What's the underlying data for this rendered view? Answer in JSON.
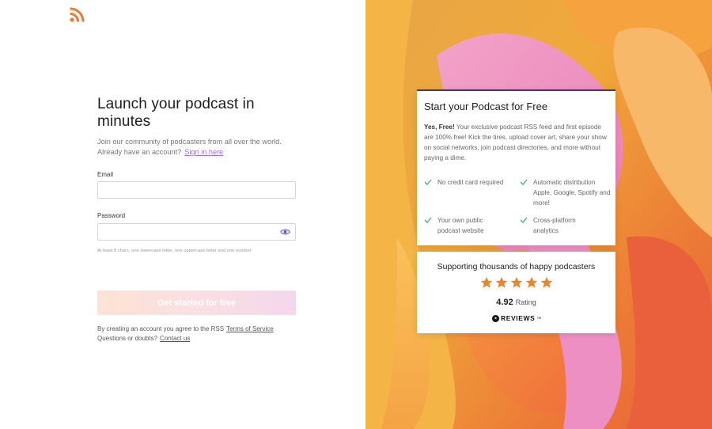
{
  "app": {
    "logo": "rss-icon"
  },
  "signup": {
    "headline": "Launch your podcast in minutes",
    "intro": "Join our community of podcasters from all over the world.",
    "have_account": "Already have an account?",
    "signin_link": "Sign in here",
    "email_label": "Email",
    "email_value": "",
    "password_label": "Password",
    "password_value": "",
    "password_hint": "At least 8 chars, one lowercase letter, one uppercase letter and one number",
    "cta_label": "Get started for free",
    "terms_text": "By creating an account you agree to the RSS",
    "terms_link": "Terms of Service",
    "questions_text": "Questions or doubts?",
    "contact_link": "Contact us"
  },
  "promo": {
    "title": "Start your Podcast for Free",
    "lead": "Yes, Free!",
    "body": "Your exclusive podcast RSS feed and first episode are 100% free! Kick the tires, upload cover art, share your show on social networks, join podcast directories, and more without paying a dime.",
    "features": [
      "No credit card required",
      "Automatic distribution Apple, Google, Spotify and more!",
      "Your own public podcast website",
      "Cross-platform analytics"
    ]
  },
  "reviews": {
    "title": "Supporting thousands of happy podcasters",
    "stars": 5,
    "rating": "4.92",
    "rating_label": "Rating",
    "brand": "REVIEWS",
    "brand_suffix": "io"
  },
  "colors": {
    "accent_link": "#9b72c9",
    "cta_gradient_start": "#fde3d4",
    "cta_gradient_end": "#f4d7ec",
    "card_top_border": "#2c3c8c",
    "check": "#3fae6a",
    "star": "#e8852e",
    "logo": "#f07a2b"
  }
}
